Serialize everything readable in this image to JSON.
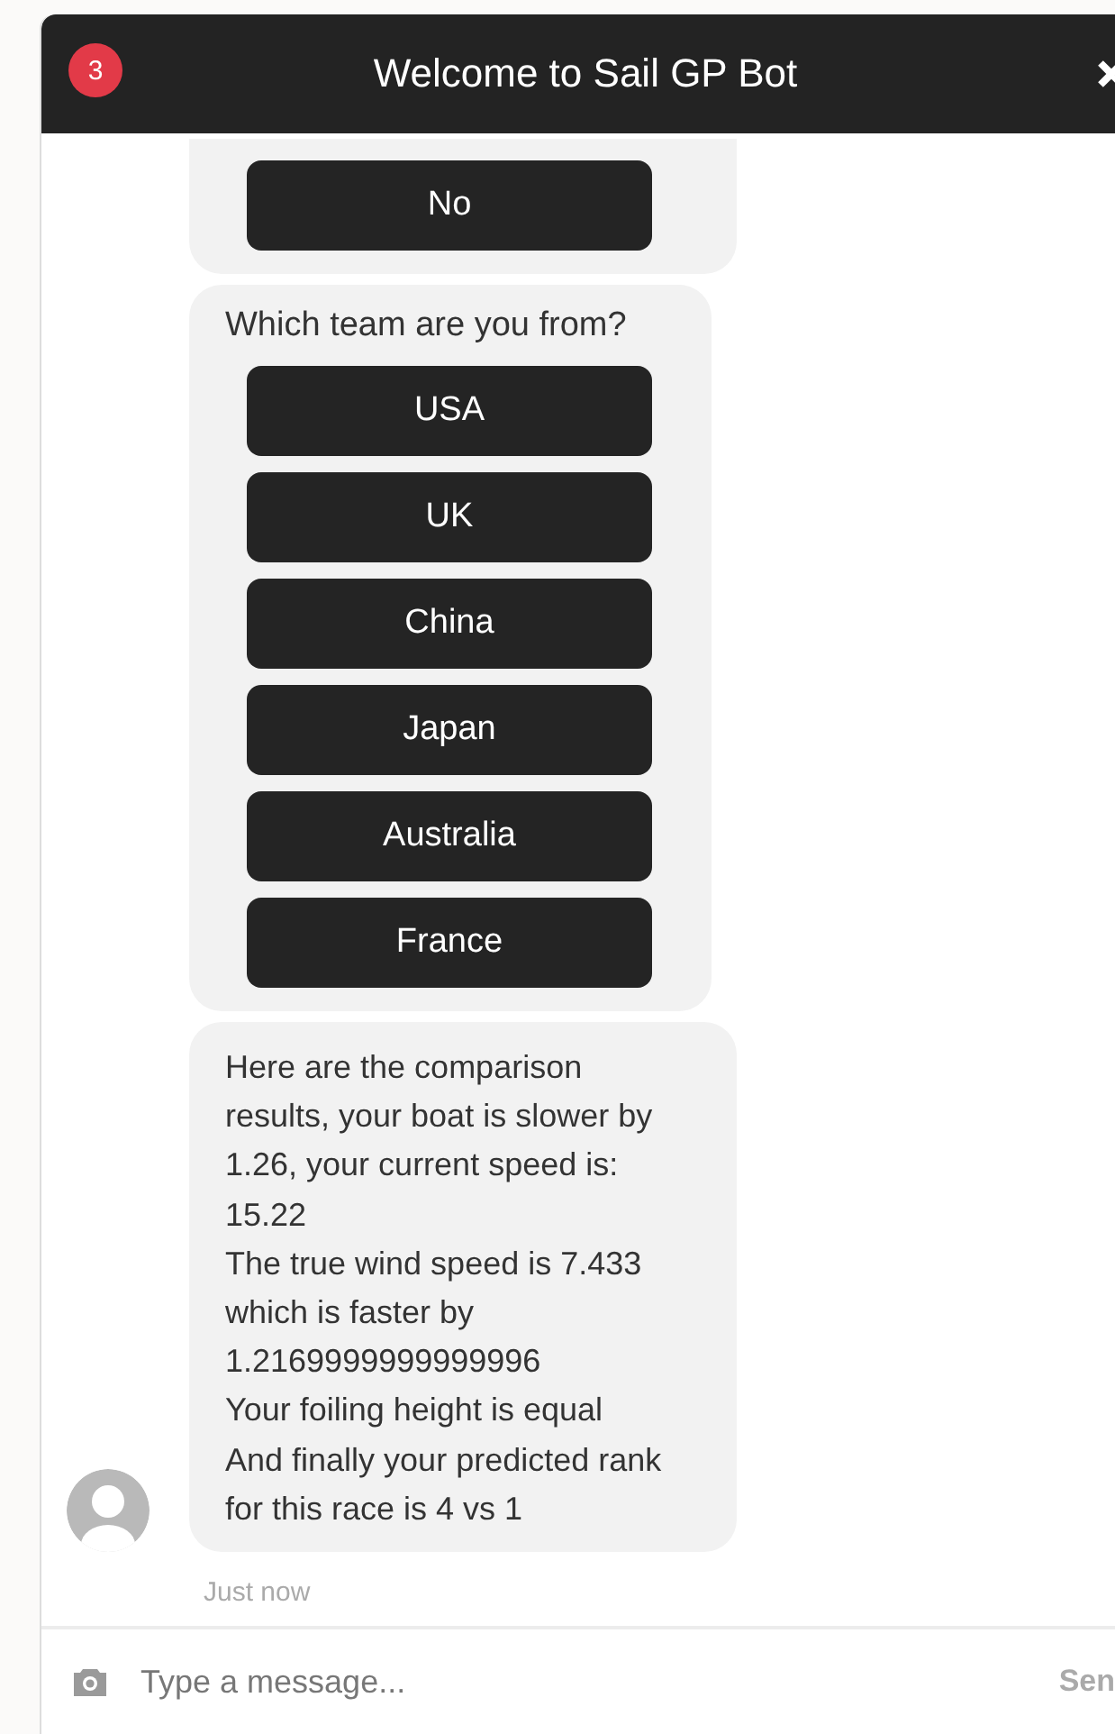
{
  "header": {
    "badge": "3",
    "title": "Welcome to Sail GP Bot"
  },
  "messages": [
    {
      "kind": "options",
      "options": [
        "No"
      ]
    },
    {
      "kind": "options",
      "prompt": "Which team are you from?",
      "options": [
        "USA",
        "UK",
        "China",
        "Japan",
        "Australia",
        "France"
      ]
    },
    {
      "kind": "text",
      "lines": [
        "Here are the comparison results, your boat is slower by 1.26, your current speed is: 15.22",
        "The true wind speed is 7.433 which is faster by 1.2169999999999996",
        "Your foiling height is equal",
        "And finally your predicted rank for this race is 4 vs 1"
      ]
    }
  ],
  "timestamp": "Just now",
  "composer": {
    "placeholder": "Type a message...",
    "send": "Sen"
  }
}
